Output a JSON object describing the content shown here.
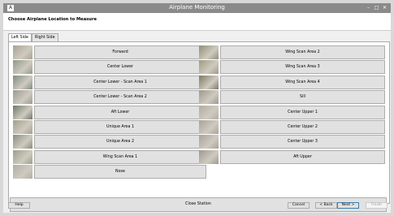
{
  "window": {
    "title": "Airplane Monitoring",
    "app_icon": "A",
    "minimize": "–",
    "maximize": "□",
    "close": "✕"
  },
  "header": {
    "heading": "Choose Airplane Location to Measure"
  },
  "tabs": [
    {
      "label": "Left Side",
      "active": true
    },
    {
      "label": "Right Side",
      "active": false
    }
  ],
  "left_column": [
    {
      "label": "Forward",
      "thumb_color": "#a9a293"
    },
    {
      "label": "Center Lower",
      "thumb_color": "#8f9a87"
    },
    {
      "label": "Center Lower - Scan Area 1",
      "thumb_color": "#7f8c84"
    },
    {
      "label": "Center Lower - Scan Area 2",
      "thumb_color": "#9c9a8e"
    },
    {
      "label": "Aft Lower",
      "thumb_color": "#6e7a6c"
    },
    {
      "label": "Unique Area 1",
      "thumb_color": "#a4a08a"
    },
    {
      "label": "Unique Area 2",
      "thumb_color": "#8a8e7c"
    },
    {
      "label": "Wing Scan Area 1",
      "thumb_color": "#9aa08b"
    },
    {
      "label": "Nose",
      "thumb_color": "#b3aea4"
    }
  ],
  "right_column": [
    {
      "label": "Wing Scan Area 2",
      "thumb_color": "#8f8f76"
    },
    {
      "label": "Wing Scan Area 3",
      "thumb_color": "#a19a80"
    },
    {
      "label": "Wing Scan Area 4",
      "thumb_color": "#7d7a64"
    },
    {
      "label": "Sill",
      "thumb_color": "#9d998e"
    },
    {
      "label": "Center Upper 1",
      "thumb_color": "#b4aba3"
    },
    {
      "label": "Center Upper 2",
      "thumb_color": "#a9a29c"
    },
    {
      "label": "Center Upper 3",
      "thumb_color": "#a8a199"
    },
    {
      "label": "Aft Upper",
      "thumb_color": "#9e9890"
    }
  ],
  "close_station": "Close Station",
  "footer": {
    "help": "Help",
    "cancel": "Cancel",
    "back": "< Back",
    "next": "Next >",
    "finish": "Finish"
  }
}
